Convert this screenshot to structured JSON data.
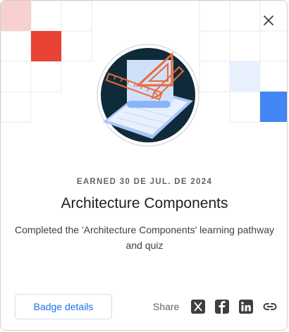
{
  "dialog": {
    "earned_label": "EARNED 30 DE JUL. DE 2024",
    "badge_title": "Architecture Components",
    "description": "Completed the 'Architecture Components' learning pathway and quiz",
    "badge_details_label": "Badge details",
    "share_label": "Share"
  },
  "icons": {
    "close": "close-icon",
    "share": [
      "x-twitter-icon",
      "facebook-icon",
      "linkedin-icon",
      "link-icon"
    ]
  },
  "colors": {
    "accent_red": "#ea4335",
    "accent_blue": "#4285f4",
    "light_red": "#f8d0ce",
    "light_blue": "#e8f0fe",
    "badge_bg": "#0f2a38",
    "link_blue": "#1a73e8"
  }
}
